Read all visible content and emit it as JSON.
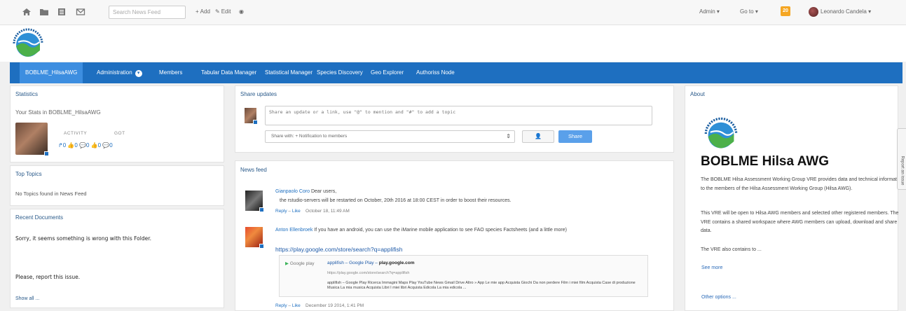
{
  "topbar": {
    "search_placeholder": "Search News Feed",
    "add_label": "Add",
    "edit_label": "Edit",
    "admin_label": "Admin",
    "goto_label": "Go to",
    "notification_count": "20",
    "user_name": "Leonardo Candela"
  },
  "nav": {
    "items": [
      {
        "label": "BOBLME_HilsaAWG",
        "active": true
      },
      {
        "label": "Administration"
      },
      {
        "label": "Members"
      },
      {
        "label": "Tabular Data Manager"
      },
      {
        "label": "Statistical Manager"
      },
      {
        "label": "Species Discovery"
      },
      {
        "label": "Geo Explorer"
      },
      {
        "label": "Authoriss Node"
      }
    ]
  },
  "statistics": {
    "title": "Statistics",
    "subtitle": "Your Stats in BOBLME_HilsaAWG",
    "activity_label": "ACTIVITY",
    "got_label": "GOT",
    "counts": "↱0 👍0 💬0   👍0 💬0"
  },
  "top_topics": {
    "title": "Top Topics",
    "text": "No Topics found in News Feed"
  },
  "recent_documents": {
    "title": "Recent Documents",
    "error_line1": "Sorry, it seems something is wrong with this Folder.",
    "error_line2": "Please, report this issue.",
    "show_all": "Show all ..."
  },
  "share": {
    "title": "Share updates",
    "placeholder": "Share an update or a link, use \"@\" to mention and \"#\" to add a topic",
    "share_with": "Share with: + Notification to members",
    "share_button": "Share"
  },
  "feed": {
    "title": "News feed",
    "posts": [
      {
        "author": "Gianpaolo Coro",
        "text_line1": " Dear users,",
        "text_line2": "the rstudio-servers will be restarted on October, 20th 2016 at 18:00 CEST in order to boost their resources.",
        "reply": "Reply",
        "like": "Like",
        "date": "October 18, 11:49 AM"
      },
      {
        "author": "Anton Ellenbroek",
        "text_line1": " If you have an android, you can use the iMarine mobile application to see FAO species Factsheets (and a little more)",
        "link": "https://play.google.com/store/search?q=applifish",
        "preview_logo": "Google play",
        "preview_title": "applifish – Google Play – ",
        "preview_domain": "play.google.com",
        "preview_url": "https://play.google.com/store/search?q=applifish",
        "preview_desc": "applifish – Google Play Ricerca Immagini Maps Play YouTube News Gmail Drive Altro » App Le mie app Acquista Giochi Da non perdere Film i miei film Acquista Case di produzione Musica La mia musica Acquista Libri I miei libri Acquista Edicola La mia edicola ...",
        "reply": "Reply",
        "like": "Like",
        "date": "December 19 2014, 1:41 PM"
      }
    ]
  },
  "about": {
    "title": "About",
    "heading": "BOBLME Hilsa AWG",
    "p1": "The BOBLME Hilsa Assessment Working Group VRE provides data and technical information to the members of the Hilsa Assessment Working Group (Hilsa AWG).",
    "p2": "This VRE will be open to Hilsa AWG members and selected other registered members. The VRE contains a shared workspace where AWG members can upload, download and share data.",
    "p3": "The VRE also contains to ...",
    "see_more": "See more",
    "other_options": "Other options ..."
  },
  "report_tab": "Report an issue",
  "colors": {
    "nav": "#1e6fc0",
    "nav_active": "#3d8ee0",
    "share_button": "#5aa0ea",
    "badge": "#f5a623"
  }
}
